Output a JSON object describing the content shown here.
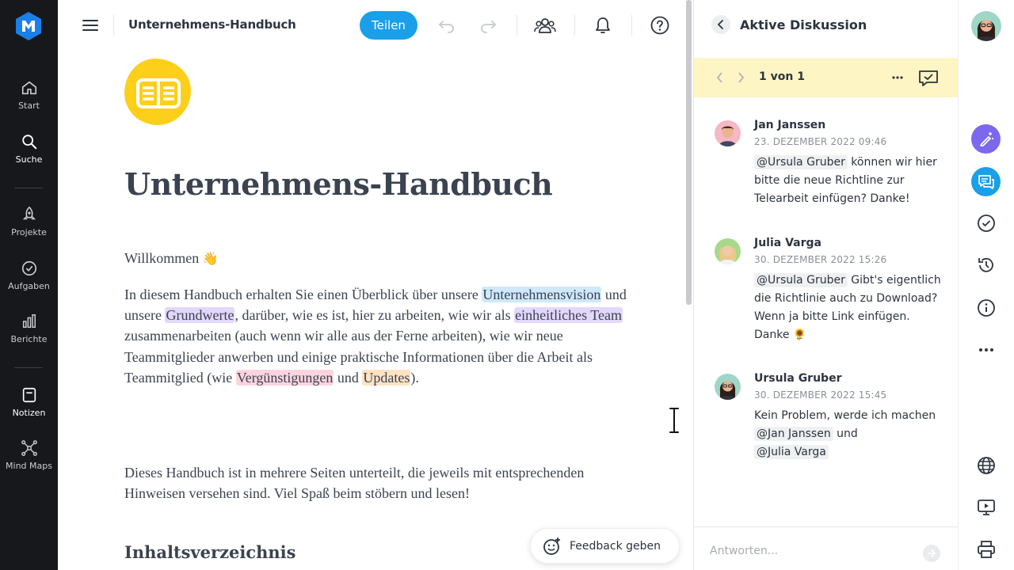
{
  "app": {
    "brand_color": "#1a7fe8"
  },
  "nav": {
    "items": [
      {
        "label": "Start",
        "icon": "home-icon"
      },
      {
        "label": "Suche",
        "icon": "search-icon"
      },
      {
        "label": "Projekte",
        "icon": "rocket-icon"
      },
      {
        "label": "Aufgaben",
        "icon": "check-circle-icon"
      },
      {
        "label": "Berichte",
        "icon": "bar-chart-icon"
      },
      {
        "label": "Notizen",
        "icon": "note-icon",
        "active": true
      },
      {
        "label": "Mind Maps",
        "icon": "mindmap-icon"
      }
    ]
  },
  "topbar": {
    "title": "Unternehmens-Handbuch",
    "share_label": "Teilen"
  },
  "document": {
    "heading": "Unternehmens-Handbuch",
    "welcome": "Willkommen",
    "welcome_emoji": "👋",
    "intro": {
      "t1": "In diesem Handbuch erhalten Sie einen Überblick über unsere ",
      "h1": "Unternehmensvision",
      "t2": " und unsere ",
      "h2": "Grundwerte",
      "t3": ", darüber, wie es ist, hier zu arbeiten, wie wir als ",
      "h3": "einheitliches Team",
      "t4": " zusammenarbeiten (auch wenn wir alle aus der Ferne arbeiten), wie wir neue Teammitglieder anwerben und einige praktische Informationen über die Arbeit als Teammitglied (wie ",
      "h4": "Vergünstigungen",
      "t5": " und ",
      "h5": "Updates",
      "t6": ")."
    },
    "para2": "Dieses Handbuch ist in mehrere Seiten unterteilt, die jeweils mit entsprechenden Hinweisen versehen sind. Viel Spaß beim stöbern und lesen!",
    "toc_heading": "Inhaltsverzeichnis"
  },
  "feedback": {
    "label": "Feedback geben"
  },
  "discussion": {
    "title": "Aktive Diskussion",
    "pager": "1 von 1",
    "comments": [
      {
        "author": "Jan Janssen",
        "date": "23. DEZEMBER 2022 09:46",
        "mention": "@Ursula Gruber",
        "text": " können wir hier bitte die neue Richtline zur Telearbeit einfügen? Danke!"
      },
      {
        "author": "Julia Varga",
        "date": "30. DEZEMBER 2022 15:26",
        "mention": "@Ursula Gruber",
        "text": " Gibt's eigentlich die Richtlinie auch zu Download? Wenn ja bitte Link einfügen. Danke 🌻"
      },
      {
        "author": "Ursula Gruber",
        "date": "30. DEZEMBER 2022 15:45",
        "text": "Kein Problem, werde ich machen ",
        "mention": "@Jan Janssen",
        "text2": " und ",
        "mention2": "@Julia Varga"
      }
    ],
    "reply_placeholder": "Antworten..."
  },
  "colors": {
    "share": "#1a9fe8",
    "pager_bg": "#fdf5c4",
    "emoji_yellow": "#fccf1a",
    "rail_ai": "#7b68ee",
    "rail_chat": "#1a9fe8"
  }
}
